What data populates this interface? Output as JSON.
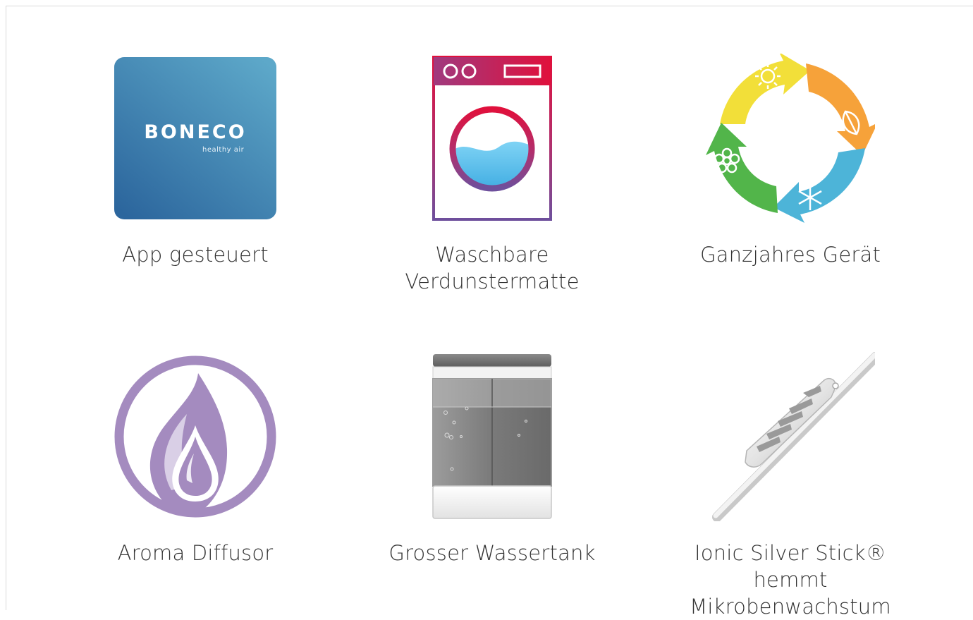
{
  "features": [
    {
      "id": "app",
      "lines": [
        "App gesteuert"
      ],
      "icon": "app-icon"
    },
    {
      "id": "mat",
      "lines": [
        "Waschbare",
        "Verdunstermatte"
      ],
      "icon": "washing-machine-icon"
    },
    {
      "id": "year",
      "lines": [
        "Ganzjahres Gerät"
      ],
      "icon": "seasons-cycle-icon"
    },
    {
      "id": "aroma",
      "lines": [
        "Aroma Diffusor"
      ],
      "icon": "aroma-drop-icon"
    },
    {
      "id": "tank",
      "lines": [
        "Grosser Wassertank"
      ],
      "icon": "water-tank-icon"
    },
    {
      "id": "stick",
      "lines": [
        "Ionic Silver Stick®",
        "hemmt Mikrobenwachstum"
      ],
      "icon": "silver-stick-icon"
    }
  ],
  "brand": {
    "name": "BONECO",
    "tagline": "healthy air"
  },
  "colors": {
    "app_tile_top": "#5aa3c4",
    "app_tile_bottom": "#2f6aa0",
    "machine_red": "#e0103c",
    "machine_purple": "#7a4f9e",
    "water_blue": "#5cc2ee",
    "season_yellow": "#f4e03a",
    "season_orange": "#f7a438",
    "season_blue": "#4fb6d8",
    "season_green": "#54b84c",
    "aroma_purple": "#a58cc0"
  }
}
